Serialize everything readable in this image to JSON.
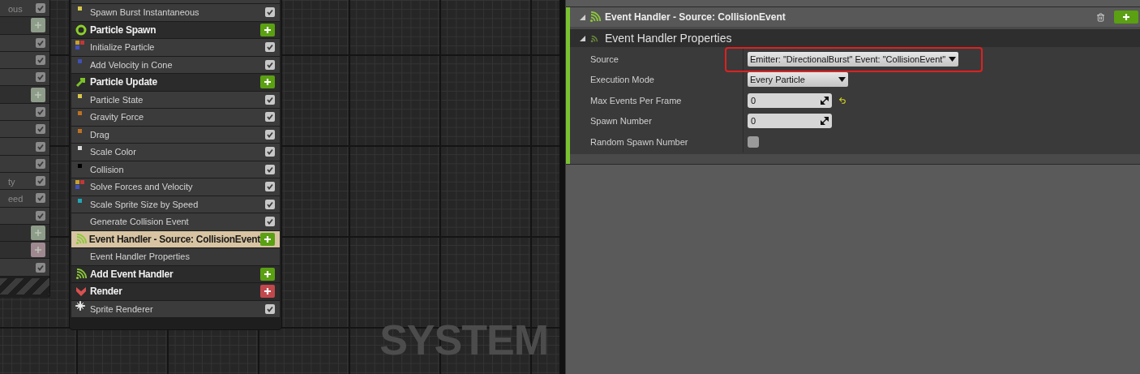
{
  "left_node": {
    "rows": [
      {
        "kind": "check",
        "text": "ous",
        "checked": true
      },
      {
        "kind": "button",
        "color": "#8e9c8a"
      },
      {
        "kind": "check",
        "checked": true
      },
      {
        "kind": "check",
        "checked": true
      },
      {
        "kind": "check",
        "checked": true
      },
      {
        "kind": "button",
        "color": "#8e9c8a"
      },
      {
        "kind": "check",
        "checked": true
      },
      {
        "kind": "check",
        "checked": true
      },
      {
        "kind": "check",
        "checked": true
      },
      {
        "kind": "check",
        "checked": true
      },
      {
        "kind": "check",
        "text": "ty",
        "checked": true
      },
      {
        "kind": "check",
        "text": "eed",
        "checked": true
      },
      {
        "kind": "check",
        "checked": true
      },
      {
        "kind": "button",
        "color": "#8e9c8a"
      },
      {
        "kind": "button",
        "color": "#a08890"
      },
      {
        "kind": "check",
        "checked": true
      }
    ]
  },
  "emitter_node": {
    "rows": [
      {
        "kind": "module",
        "label": "Spawn Burst Instantaneous",
        "color": "#d8c84a",
        "checked": true
      },
      {
        "kind": "spawn",
        "label": "Particle Spawn",
        "color": "#5aa012",
        "selected": false
      },
      {
        "kind": "multi",
        "label": "Initialize Particle",
        "checked": true
      },
      {
        "kind": "module",
        "label": "Add Velocity in Cone",
        "color": "#4050b8",
        "checked": true
      },
      {
        "kind": "update",
        "label": "Particle Update",
        "color": "#5aa012",
        "selected": false
      },
      {
        "kind": "module",
        "label": "Particle State",
        "color": "#d8c84a",
        "checked": true
      },
      {
        "kind": "module",
        "label": "Gravity Force",
        "color": "#c07020",
        "checked": true
      },
      {
        "kind": "module",
        "label": "Drag",
        "color": "#c07020",
        "checked": true
      },
      {
        "kind": "module",
        "label": "Scale Color",
        "color": "#d8d8d8",
        "checked": true
      },
      {
        "kind": "module",
        "label": "Collision",
        "color": "#000000",
        "checked": true
      },
      {
        "kind": "multi",
        "label": "Solve Forces and Velocity",
        "checked": true
      },
      {
        "kind": "module",
        "label": "Scale Sprite Size by Speed",
        "color": "#20a8b8",
        "checked": true
      },
      {
        "kind": "module",
        "label": "Generate Collision Event",
        "checked": true
      },
      {
        "kind": "event",
        "label": "Event Handler - Source: CollisionEvent",
        "color": "#5aa012",
        "selected": true
      },
      {
        "kind": "properties",
        "label": "Event Handler Properties"
      },
      {
        "kind": "event",
        "label": "Add Event Handler",
        "color": "#5aa012",
        "selected": false
      },
      {
        "kind": "render",
        "label": "Render",
        "color": "#c0484c",
        "selected": false
      },
      {
        "kind": "renderer",
        "label": "Sprite Renderer",
        "checked": true
      }
    ]
  },
  "graph": {
    "watermark": "SYSTEM"
  },
  "details": {
    "title": "Event Handler - Source: CollisionEvent",
    "section": "Event Handler Properties",
    "properties": [
      {
        "kind": "dropdown",
        "label": "Source",
        "value": "Emitter: \"DirectionalBurst\" Event: \"CollisionEvent\"",
        "highlighted": true
      },
      {
        "kind": "dropdown",
        "label": "Execution Mode",
        "value": "Every Particle",
        "highlighted": false
      },
      {
        "kind": "number",
        "label": "Max Events Per Frame",
        "value": "0",
        "reset": true
      },
      {
        "kind": "number",
        "label": "Spawn Number",
        "value": "0",
        "reset": false
      },
      {
        "kind": "checkbox",
        "label": "Random Spawn Number",
        "checked": false
      }
    ]
  }
}
